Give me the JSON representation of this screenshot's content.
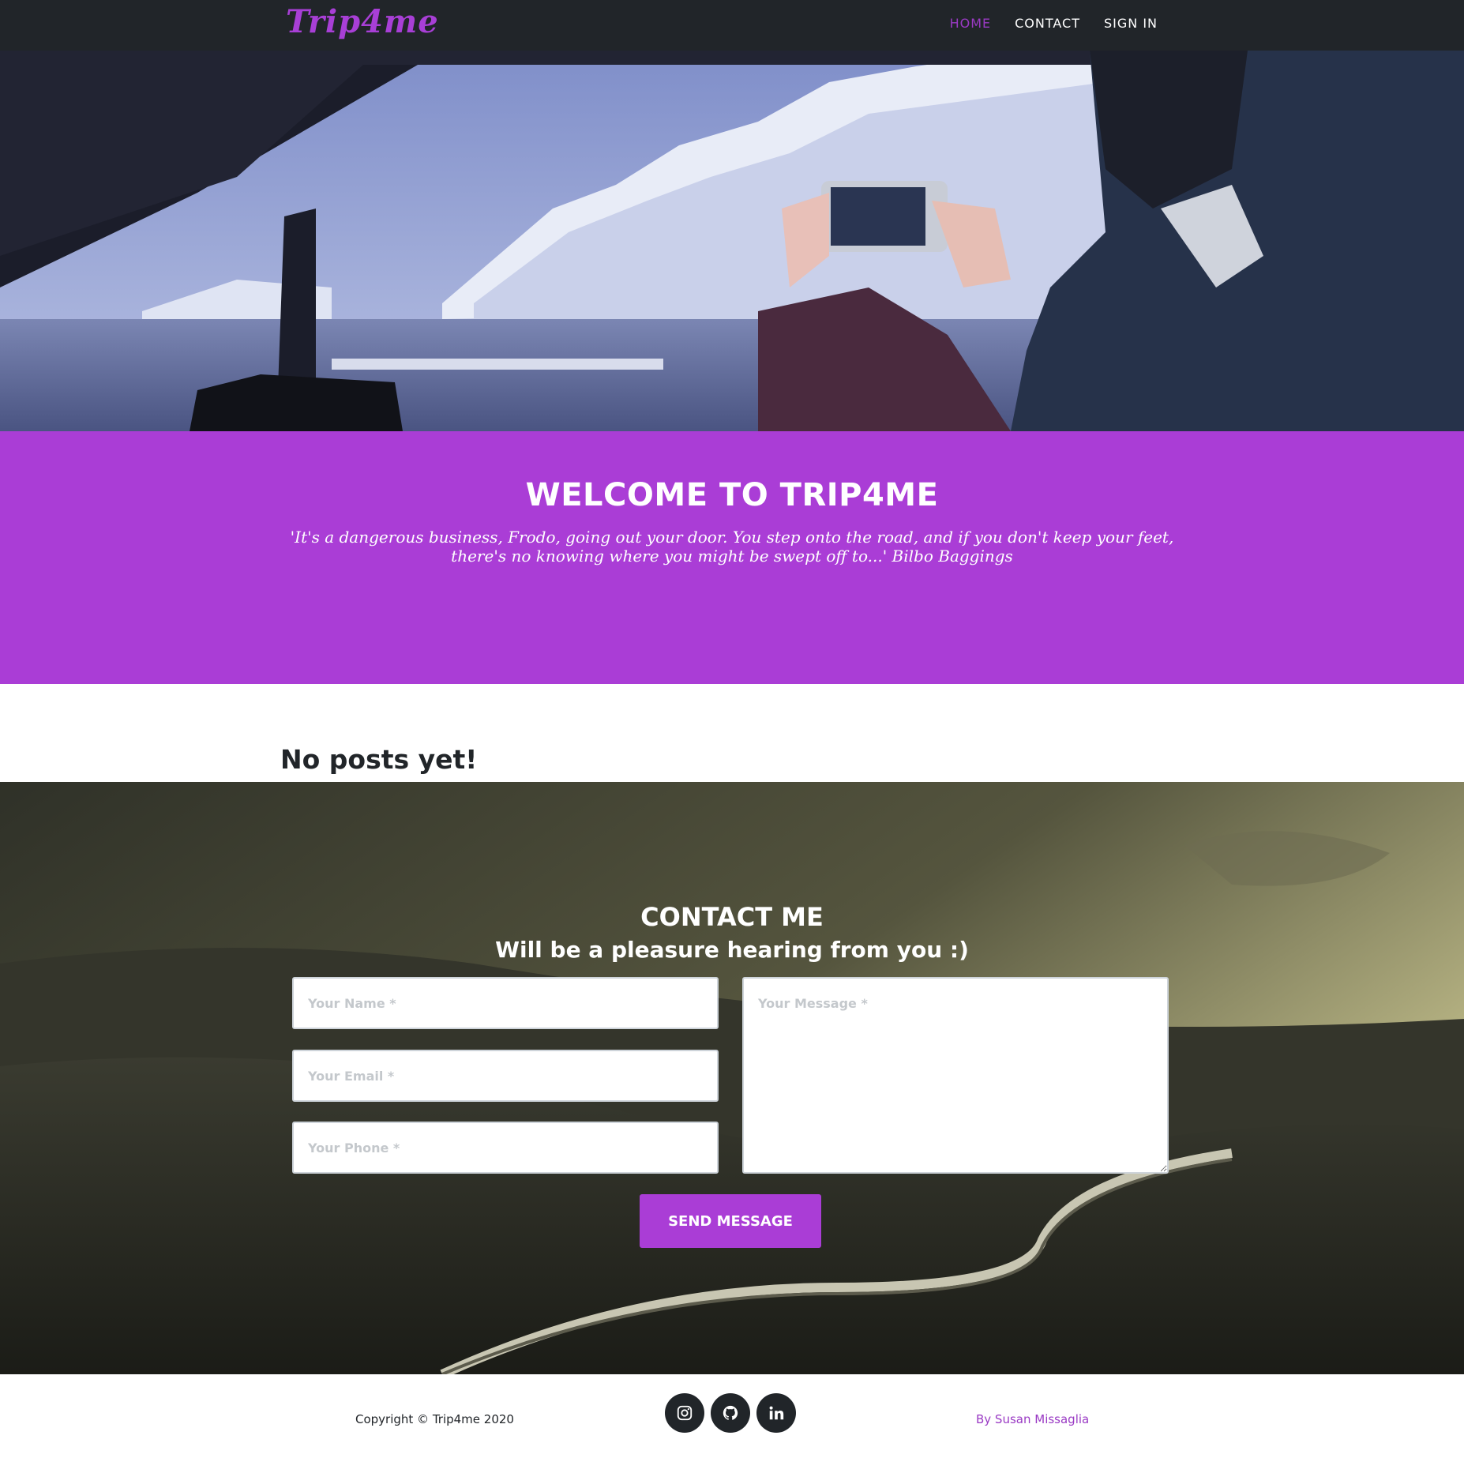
{
  "navbar": {
    "brand": "Trip4me",
    "links": [
      {
        "label": "HOME",
        "active": true
      },
      {
        "label": "CONTACT",
        "active": false
      },
      {
        "label": "SIGN IN",
        "active": false
      }
    ]
  },
  "welcome": {
    "title": "WELCOME TO TRIP4ME",
    "quote": "'It's a dangerous business, Frodo, going out your door. You step onto the road, and if you don't keep your feet, there's no knowing where you might be swept off to...' Bilbo Baggings"
  },
  "posts": {
    "empty_message": "No posts yet!"
  },
  "contact": {
    "title": "CONTACT ME",
    "subtitle": "Will be a pleasure hearing from you :)",
    "name_placeholder": "Your Name *",
    "email_placeholder": "Your Email *",
    "phone_placeholder": "Your Phone *",
    "message_placeholder": "Your Message *",
    "send_label": "SEND MESSAGE"
  },
  "footer": {
    "copyright": "Copyright © Trip4me 2020",
    "socials": [
      "instagram-icon",
      "github-icon",
      "linkedin-icon"
    ],
    "author": "By Susan Missaglia"
  },
  "colors": {
    "accent": "#aa3dd6",
    "nav_bg": "#212529",
    "active_link": "#9a3ac4"
  }
}
